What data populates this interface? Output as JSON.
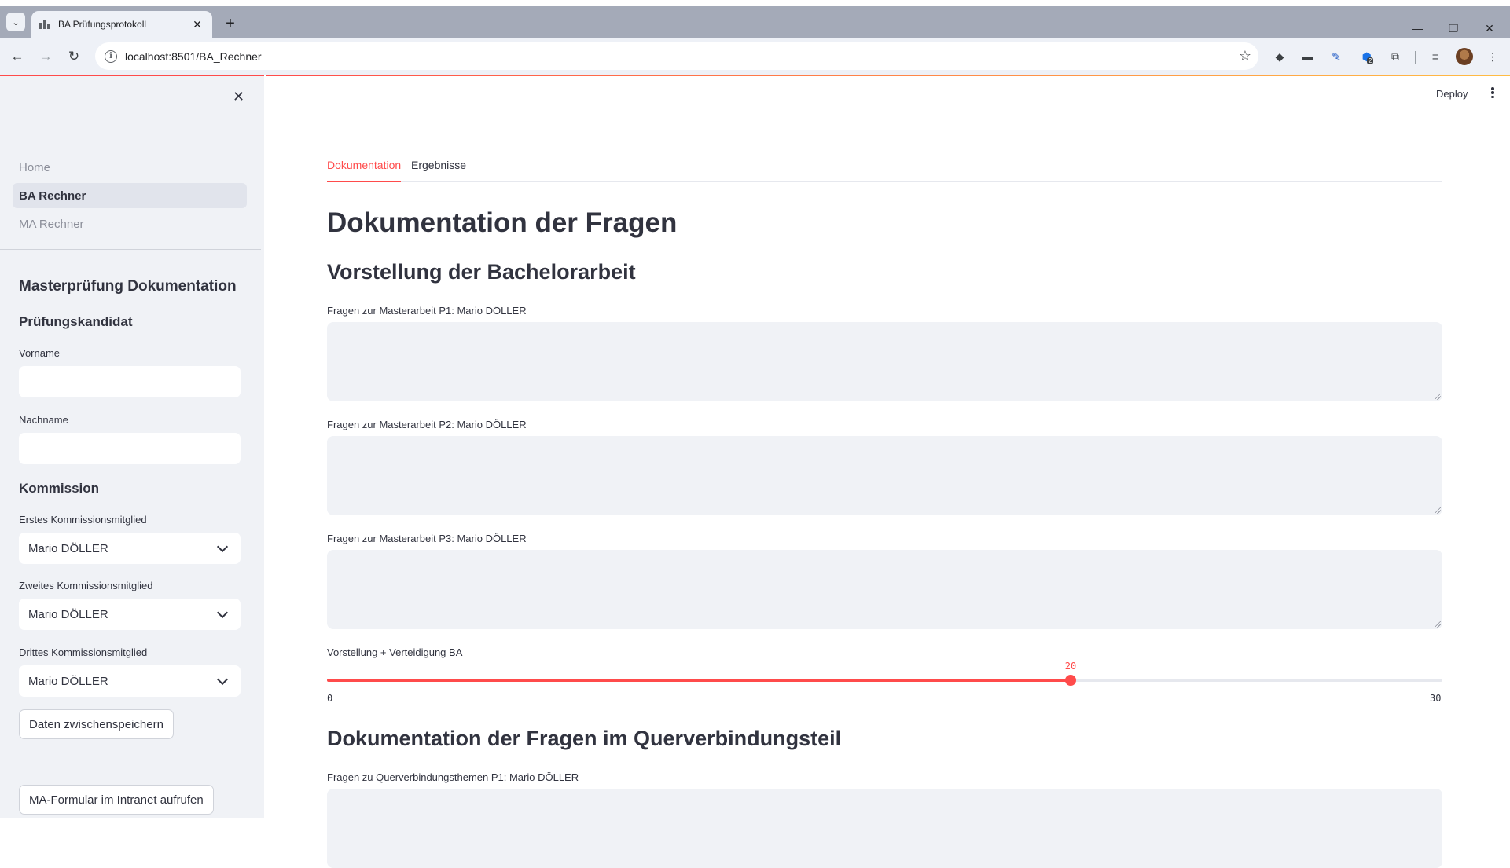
{
  "browser": {
    "tab_title": "BA Prüfungsprotokoll",
    "url": "localhost:8501/BA_Rechner",
    "extension_badge": "2"
  },
  "sidebar": {
    "nav": [
      {
        "label": "Home",
        "active": false
      },
      {
        "label": "BA Rechner",
        "active": true
      },
      {
        "label": "MA Rechner",
        "active": false
      }
    ],
    "section_title": "Masterprüfung Dokumentation",
    "candidate": {
      "heading": "Prüfungskandidat",
      "first_name_label": "Vorname",
      "first_name_value": "",
      "last_name_label": "Nachname",
      "last_name_value": ""
    },
    "commission": {
      "heading": "Kommission",
      "members": [
        {
          "label": "Erstes Kommissionsmitglied",
          "value": "Mario DÖLLER"
        },
        {
          "label": "Zweites Kommissionsmitglied",
          "value": "Mario DÖLLER"
        },
        {
          "label": "Drittes Kommissionsmitglied",
          "value": "Mario DÖLLER"
        }
      ]
    },
    "save_button": "Daten zwischenspeichern",
    "intranet_button": "MA-Formular im Intranet aufrufen"
  },
  "header": {
    "deploy_label": "Deploy"
  },
  "main": {
    "tabs": [
      {
        "label": "Dokumentation",
        "active": true
      },
      {
        "label": "Ergebnisse",
        "active": false
      }
    ],
    "title": "Dokumentation der Fragen",
    "section1": {
      "heading": "Vorstellung der Bachelorarbeit",
      "questions": [
        {
          "label": "Fragen zur Masterarbeit P1: Mario DÖLLER",
          "value": ""
        },
        {
          "label": "Fragen zur Masterarbeit P2: Mario DÖLLER",
          "value": ""
        },
        {
          "label": "Fragen zur Masterarbeit P3: Mario DÖLLER",
          "value": ""
        }
      ],
      "slider": {
        "label": "Vorstellung + Verteidigung BA",
        "min": 0,
        "max": 30,
        "value": 20,
        "min_label": "0",
        "max_label": "30",
        "value_label": "20"
      }
    },
    "section2": {
      "heading": "Dokumentation der Fragen im Querverbindungsteil",
      "questions": [
        {
          "label": "Fragen zu Querverbindungsthemen P1: Mario DÖLLER",
          "value": ""
        }
      ]
    }
  },
  "colors": {
    "accent": "#ff4b4b",
    "sidebar_bg": "#f0f2f6",
    "text": "#31333f"
  }
}
